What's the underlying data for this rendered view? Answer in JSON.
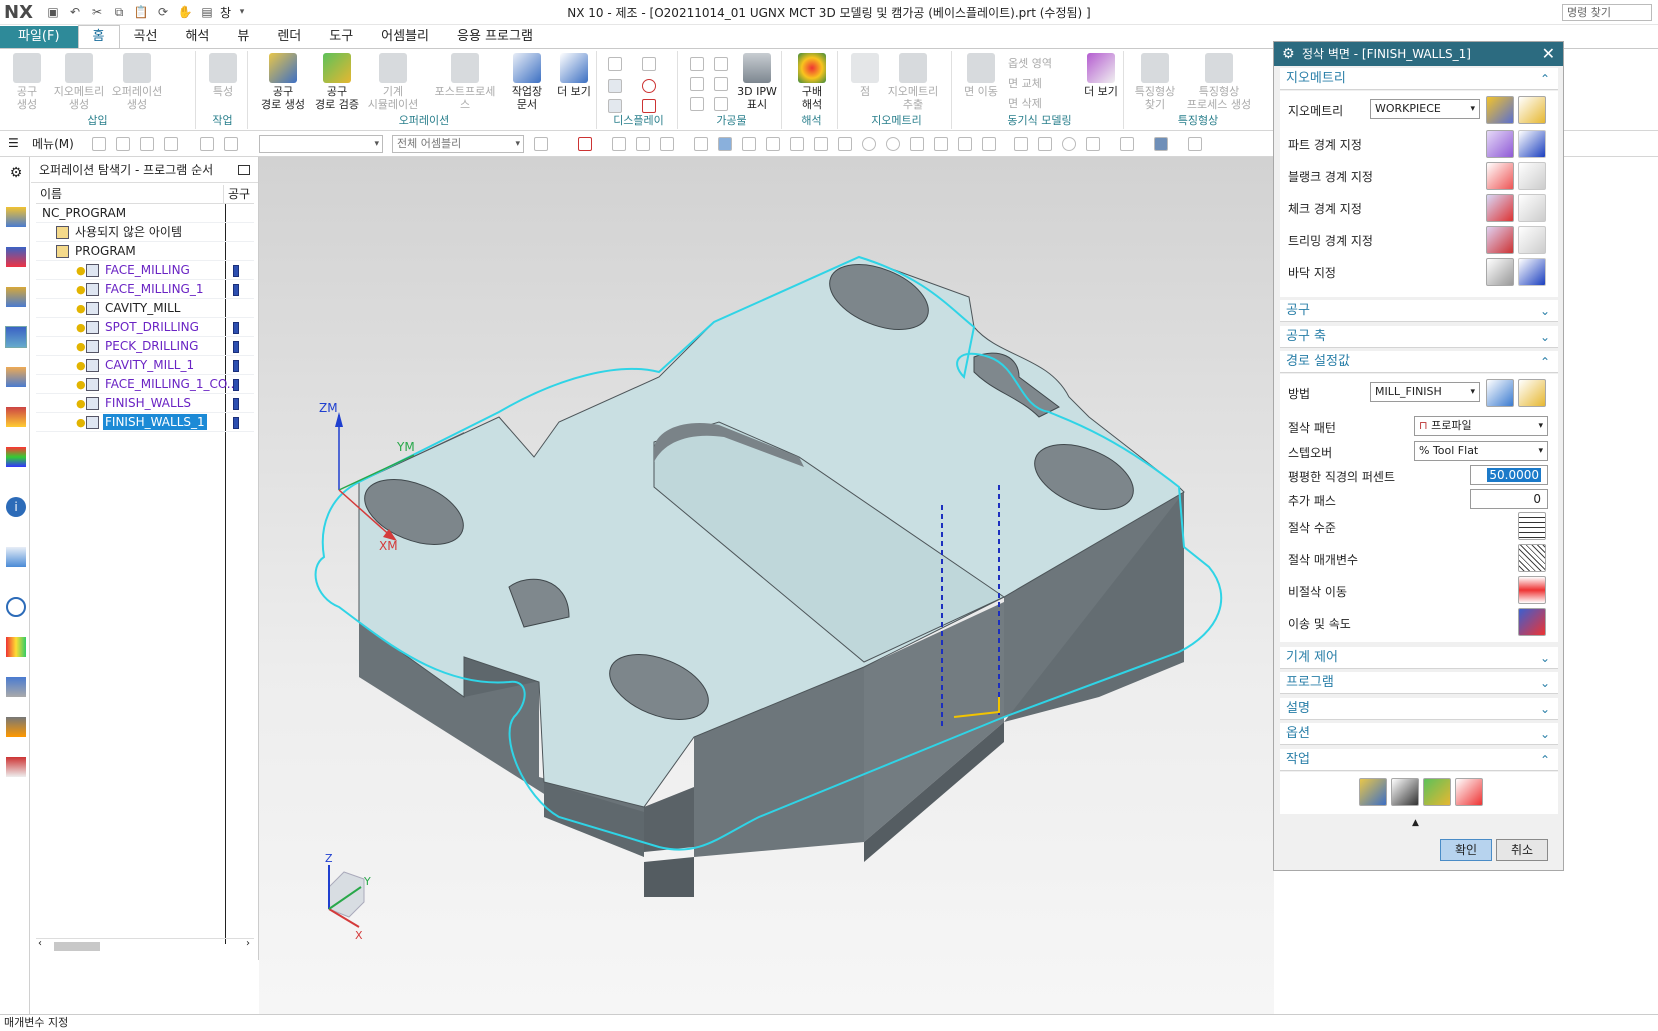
{
  "app": {
    "logo": "NX",
    "window_title": "NX 10 - 제조 - [O20211014_01 UGNX MCT 3D 모델링 및 캠가공 (베이스플레이트).prt (수정됨) ]",
    "window_menu": "창",
    "command_search": "명령 찾기"
  },
  "ribbon_tabs": [
    "파일(F)",
    "홈",
    "곡선",
    "해석",
    "뷰",
    "렌더",
    "도구",
    "어셈블리",
    "응용 프로그램"
  ],
  "ribbon": {
    "groups": [
      {
        "label": "삽입",
        "buttons": [
          "공구\n생성",
          "지오메트리\n생성",
          "오퍼레이션\n생성"
        ]
      },
      {
        "label": "작업",
        "buttons": [
          "특성"
        ]
      },
      {
        "label": "오퍼레이션",
        "buttons": [
          "공구\n경로 생성",
          "공구\n경로 검증",
          "기계\n시뮬레이션",
          "포스트프로세스",
          "작업장\n문서",
          "더 보기"
        ]
      },
      {
        "label": "디스플레이",
        "buttons": []
      },
      {
        "label": "가공물",
        "buttons": [
          "3D IPW\n표시"
        ]
      },
      {
        "label": "해석",
        "buttons": [
          "구배\n해석"
        ]
      },
      {
        "label": "지오메트리",
        "buttons": [
          "점",
          "지오메트리\n추출"
        ]
      },
      {
        "label": "동기식 모델링",
        "buttons": [
          "면 이동",
          "옵셋 영역",
          "면 교체",
          "면 삭제",
          "더 보기"
        ]
      },
      {
        "label": "특징형상",
        "buttons": [
          "특징형상\n찾기",
          "특징형상\n프로세스 생성"
        ]
      }
    ]
  },
  "toolbar2": {
    "menu": "메뉴(M)",
    "filter_placeholder": "",
    "scope": "전체 어셈블리"
  },
  "navigator": {
    "title": "오퍼레이션 탐색기 - 프로그램 순서",
    "col_name": "이름",
    "col_tool": "공구",
    "rows": [
      {
        "label": "NC_PROGRAM",
        "indent": 0,
        "kind": "root",
        "tool": false
      },
      {
        "label": "사용되지 않은 아이템",
        "indent": 1,
        "kind": "folder",
        "tool": false
      },
      {
        "label": "PROGRAM",
        "indent": 1,
        "kind": "program",
        "tool": false
      },
      {
        "label": "FACE_MILLING",
        "indent": 2,
        "kind": "op",
        "purple": true,
        "tool": true
      },
      {
        "label": "FACE_MILLING_1",
        "indent": 2,
        "kind": "op",
        "purple": true,
        "tool": true
      },
      {
        "label": "CAVITY_MILL",
        "indent": 2,
        "kind": "op",
        "purple": false,
        "tool": false
      },
      {
        "label": "SPOT_DRILLING",
        "indent": 2,
        "kind": "op",
        "purple": true,
        "tool": true
      },
      {
        "label": "PECK_DRILLING",
        "indent": 2,
        "kind": "op",
        "purple": true,
        "tool": true
      },
      {
        "label": "CAVITY_MILL_1",
        "indent": 2,
        "kind": "op",
        "purple": true,
        "tool": true
      },
      {
        "label": "FACE_MILLING_1_CO...",
        "indent": 2,
        "kind": "op",
        "purple": true,
        "tool": true
      },
      {
        "label": "FINISH_WALLS",
        "indent": 2,
        "kind": "op",
        "purple": true,
        "tool": true
      },
      {
        "label": "FINISH_WALLS_1",
        "indent": 2,
        "kind": "op",
        "purple": true,
        "tool": true,
        "selected": true
      }
    ]
  },
  "viewport": {
    "wcs": {
      "z": "ZM",
      "y": "YM",
      "x": "XM"
    },
    "triad": {
      "z": "Z",
      "y": "Y",
      "x": "X"
    },
    "colors": {
      "part_top": "#c9dfe2",
      "part_side": "#6e767a",
      "toolpath": "#2fd4e6",
      "tool_axis": "#1c2fbf"
    }
  },
  "dialog": {
    "title": "정삭 벽면 - [FINISH_WALLS_1]",
    "geometry": {
      "header": "지오메트리",
      "geometry_label": "지오메트리",
      "geometry_value": "WORKPIECE",
      "rows": [
        "파트 경계 지정",
        "블랭크 경계 지정",
        "체크 경계 지정",
        "트리밍 경계 지정",
        "바닥 지정"
      ]
    },
    "tool_header": "공구",
    "tool_axis_header": "공구 축",
    "path": {
      "header": "경로 설정값",
      "method_label": "방법",
      "method_value": "MILL_FINISH",
      "cut_pattern_label": "절삭 패턴",
      "cut_pattern_value": "프로파일",
      "stepover_label": "스텝오버",
      "stepover_value": "% Tool Flat",
      "flat_pct_label": "평평한 직경의 퍼센트",
      "flat_pct_value": "50.0000",
      "extra_passes_label": "추가 패스",
      "extra_passes_value": "0",
      "cut_levels_label": "절삭 수준",
      "cut_params_label": "절삭 매개변수",
      "noncut_label": "비절삭 이동",
      "feeds_label": "이송 및 속도"
    },
    "machine_control_header": "기계 제어",
    "program_header": "프로그램",
    "description_header": "설명",
    "options_header": "옵션",
    "actions_header": "작업",
    "ok": "확인",
    "cancel": "취소"
  },
  "status": "매개변수 지정"
}
